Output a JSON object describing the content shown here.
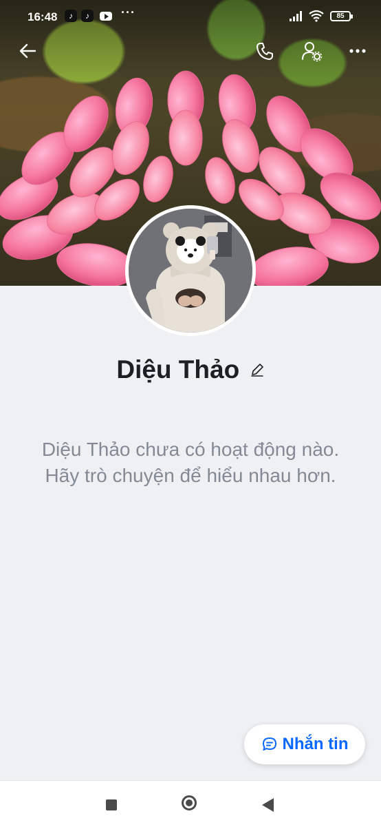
{
  "status_bar": {
    "time": "16:48",
    "battery": "85",
    "more": "···"
  },
  "profile": {
    "name": "Diệu Thảo",
    "empty_message": "Diệu Thảo chưa có hoạt động nào. Hãy trò chuyện để hiểu nhau hơn."
  },
  "actions": {
    "message_button_label": "Nhắn tin"
  },
  "colors": {
    "accent": "#0b68ff",
    "background": "#eff0f4",
    "muted_text": "#838a95"
  },
  "icons": {
    "back": "back-arrow-icon",
    "call": "phone-icon",
    "profile_settings": "user-settings-icon",
    "menu": "more-icon",
    "edit": "pencil-icon",
    "message": "chat-bubble-icon"
  }
}
